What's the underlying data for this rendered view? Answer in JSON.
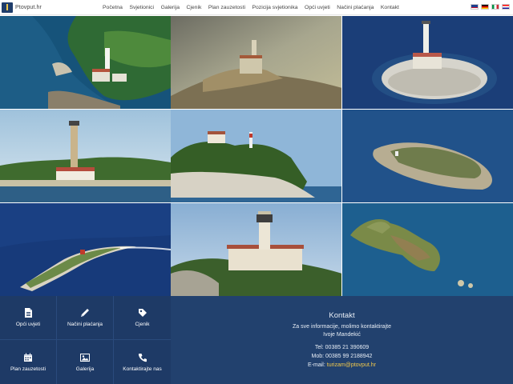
{
  "site": {
    "logo_text": "Ptovput.hr"
  },
  "nav": {
    "items": [
      "Početna",
      "Svjetionici",
      "Galerija",
      "Cjenik",
      "Plan zauzetosti",
      "Pozicija svjetionika",
      "Opći uvjeti",
      "Načini plaćanja",
      "Kontakt"
    ]
  },
  "languages": [
    {
      "code": "en",
      "icon": "uk-flag-icon"
    },
    {
      "code": "de",
      "icon": "germany-flag-icon"
    },
    {
      "code": "it",
      "icon": "italy-flag-icon"
    },
    {
      "code": "hr",
      "icon": "croatia-flag-icon"
    }
  ],
  "colors": {
    "footer_dark": "#1e3a66",
    "footer_contact": "#22416e",
    "accent_email": "#f2c94c"
  },
  "quick_links": [
    {
      "label": "Opći uvjeti",
      "icon": "document-icon"
    },
    {
      "label": "Načini plaćanja",
      "icon": "pencil-icon"
    },
    {
      "label": "Cjenik",
      "icon": "tag-icon"
    },
    {
      "label": "Plan zauzetosti",
      "icon": "calendar-icon"
    },
    {
      "label": "Galerija",
      "icon": "image-icon"
    },
    {
      "label": "Kontaktirajte nas",
      "icon": "phone-icon"
    }
  ],
  "contact": {
    "title": "Kontakt",
    "intro_line1": "Za sve informacije, molimo kontaktirajte",
    "intro_line2": "Ivoje Mandekić",
    "tel": "Tel: 00385 21 390609",
    "mob": "Mob: 00385 99 2188942",
    "email_label": "E-mail: ",
    "email": "turizam@ptovput.hr"
  }
}
